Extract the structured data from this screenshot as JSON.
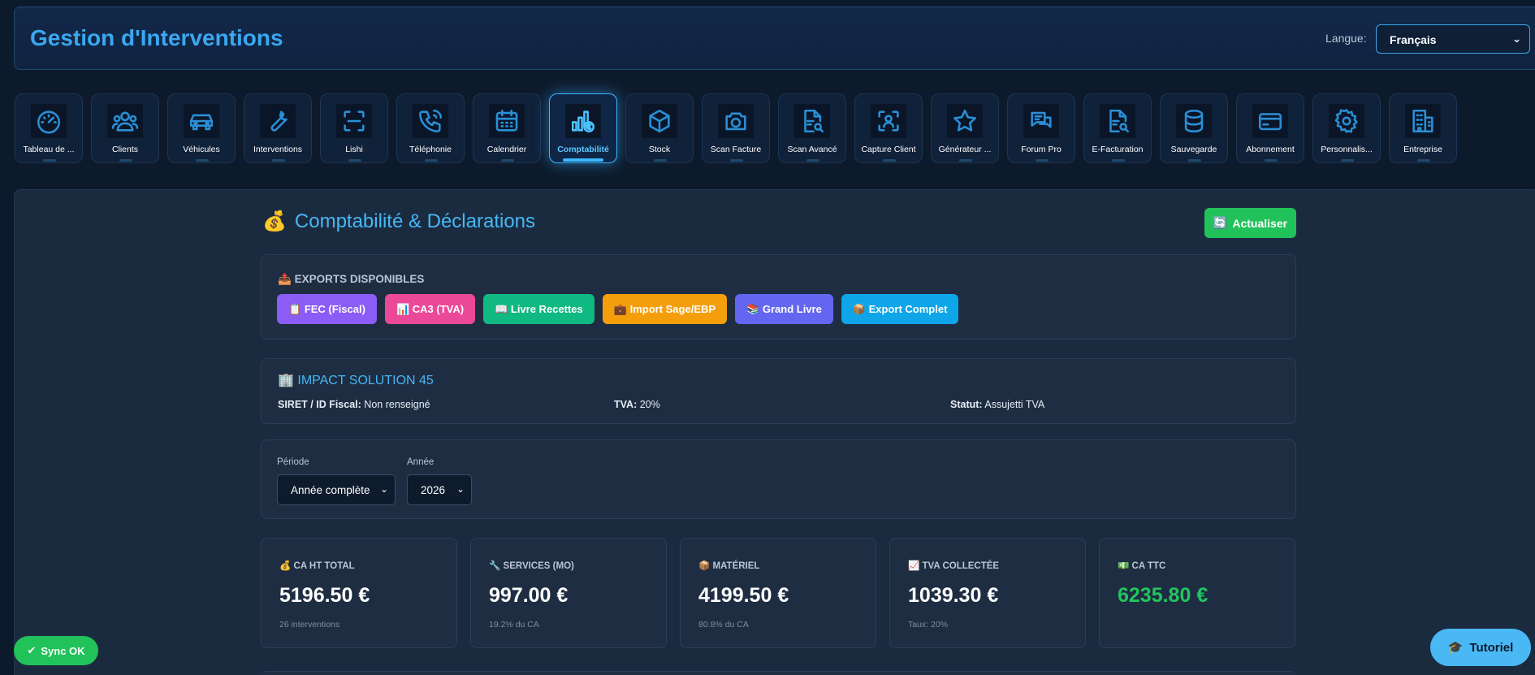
{
  "header": {
    "title": "Gestion d'Interventions",
    "lang_label": "Langue:",
    "lang_value": "Français"
  },
  "nav": [
    {
      "label": "Tableau de ...",
      "icon": "gauge-icon"
    },
    {
      "label": "Clients",
      "icon": "users-icon"
    },
    {
      "label": "Véhicules",
      "icon": "car-icon"
    },
    {
      "label": "Interventions",
      "icon": "wrench-icon"
    },
    {
      "label": "Lishi",
      "icon": "scan-frame-icon"
    },
    {
      "label": "Téléphonie",
      "icon": "phone-icon"
    },
    {
      "label": "Calendrier",
      "icon": "calendar-icon"
    },
    {
      "label": "Comptabilité",
      "icon": "accounting-chart-icon",
      "active": true
    },
    {
      "label": "Stock",
      "icon": "box-icon"
    },
    {
      "label": "Scan Facture",
      "icon": "camera-icon"
    },
    {
      "label": "Scan Avancé",
      "icon": "document-search-icon"
    },
    {
      "label": "Capture Client",
      "icon": "user-scan-icon"
    },
    {
      "label": "Générateur ...",
      "icon": "star-icon"
    },
    {
      "label": "Forum Pro",
      "icon": "chat-icon"
    },
    {
      "label": "E-Facturation",
      "icon": "document-search-icon"
    },
    {
      "label": "Sauvegarde",
      "icon": "database-icon"
    },
    {
      "label": "Abonnement",
      "icon": "credit-card-icon"
    },
    {
      "label": "Personnalis...",
      "icon": "gear-icon"
    },
    {
      "label": "Entreprise",
      "icon": "building-icon"
    }
  ],
  "page": {
    "emoji": "💰",
    "title": "Comptabilité & Déclarations",
    "refresh_icon": "🔄",
    "refresh_label": "Actualiser"
  },
  "exports": {
    "emoji": "📤",
    "title": "EXPORTS DISPONIBLES",
    "buttons": [
      {
        "emoji": "📋",
        "label": "FEC (Fiscal)",
        "color": "#8b5cf6"
      },
      {
        "emoji": "📊",
        "label": "CA3 (TVA)",
        "color": "#ec4899"
      },
      {
        "emoji": "📖",
        "label": "Livre Recettes",
        "color": "#10b981"
      },
      {
        "emoji": "💼",
        "label": "Import Sage/EBP",
        "color": "#f59e0b"
      },
      {
        "emoji": "📚",
        "label": "Grand Livre",
        "color": "#6366f1"
      },
      {
        "emoji": "📦",
        "label": "Export Complet",
        "color": "#0ea5e9"
      }
    ]
  },
  "company": {
    "emoji": "🏢",
    "name": "IMPACT SOLUTION 45",
    "siret_label": "SIRET / ID Fiscal:",
    "siret_value": "Non renseigné",
    "tva_label": "TVA:",
    "tva_value": "20%",
    "statut_label": "Statut:",
    "statut_value": "Assujetti TVA"
  },
  "filters": {
    "period_label": "Période",
    "period_value": "Année complète",
    "year_label": "Année",
    "year_value": "2026"
  },
  "kpis": [
    {
      "emoji": "💰",
      "label": "CA HT TOTAL",
      "value": "5196.50 €",
      "sub": "26 interventions",
      "color": "#ffffff"
    },
    {
      "emoji": "🔧",
      "label": "SERVICES (MO)",
      "value": "997.00 €",
      "sub": "19.2% du CA",
      "color": "#ffffff"
    },
    {
      "emoji": "📦",
      "label": "MATÉRIEL",
      "value": "4199.50 €",
      "sub": "80.8% du CA",
      "color": "#ffffff"
    },
    {
      "emoji": "📈",
      "label": "TVA COLLECTÉE",
      "value": "1039.30 €",
      "sub": "Taux: 20%",
      "color": "#ffffff"
    },
    {
      "emoji": "💵",
      "label": "CA TTC",
      "value": "6235.80 €",
      "sub": "",
      "color": "#22c55e"
    }
  ],
  "sync": {
    "icon": "✔",
    "label": "Sync OK"
  },
  "tutorial": {
    "emoji": "🎓",
    "label": "Tutoriel"
  }
}
